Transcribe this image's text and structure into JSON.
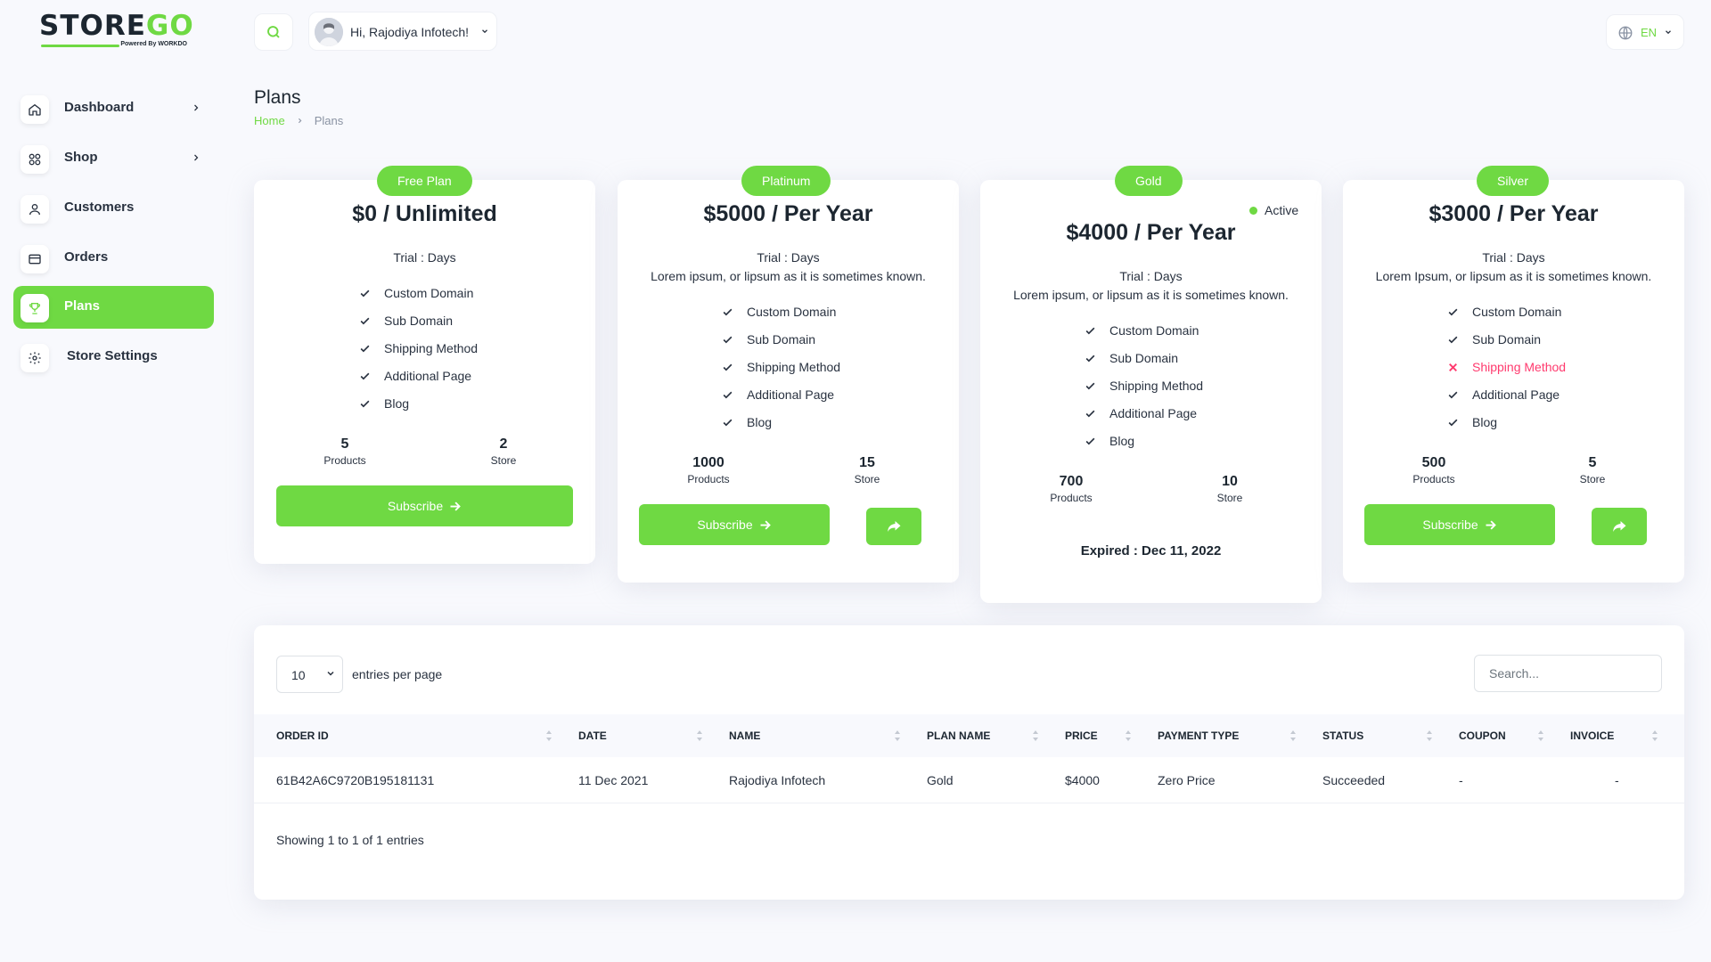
{
  "brand": {
    "name_part1": "STORE",
    "name_part2": "GO",
    "powered_by": "Powered By WORKDO"
  },
  "sidebar": {
    "items": [
      {
        "label": "Dashboard",
        "icon": "home-icon",
        "has_submenu": true
      },
      {
        "label": "Shop",
        "icon": "grid-icon",
        "has_submenu": true
      },
      {
        "label": "Customers",
        "icon": "user-icon",
        "has_submenu": false
      },
      {
        "label": "Orders",
        "icon": "card-icon",
        "has_submenu": false
      },
      {
        "label": "Plans",
        "icon": "trophy-icon",
        "has_submenu": false,
        "active": true
      },
      {
        "label": "Store Settings",
        "icon": "gear-icon",
        "has_submenu": false
      }
    ]
  },
  "header": {
    "user_greeting": "Hi, Rajodiya Infotech!",
    "language": "EN"
  },
  "page": {
    "title": "Plans",
    "breadcrumb": {
      "home": "Home",
      "current": "Plans"
    }
  },
  "plans": [
    {
      "badge": "Free Plan",
      "price": "$0 / Unlimited",
      "trial": "Trial : Days",
      "description": "",
      "features": [
        {
          "label": "Custom Domain",
          "enabled": true
        },
        {
          "label": "Sub Domain",
          "enabled": true
        },
        {
          "label": "Shipping Method",
          "enabled": true
        },
        {
          "label": "Additional Page",
          "enabled": true
        },
        {
          "label": "Blog",
          "enabled": true
        }
      ],
      "products": "5",
      "products_label": "Products",
      "stores": "2",
      "stores_label": "Store",
      "subscribe_label": "Subscribe"
    },
    {
      "badge": "Platinum",
      "price": "$5000 / Per Year",
      "trial": "Trial : Days",
      "description": "Lorem ipsum, or lipsum as it is sometimes known.",
      "features": [
        {
          "label": "Custom Domain",
          "enabled": true
        },
        {
          "label": "Sub Domain",
          "enabled": true
        },
        {
          "label": "Shipping Method",
          "enabled": true
        },
        {
          "label": "Additional Page",
          "enabled": true
        },
        {
          "label": "Blog",
          "enabled": true
        }
      ],
      "products": "1000",
      "products_label": "Products",
      "stores": "15",
      "stores_label": "Store",
      "subscribe_label": "Subscribe"
    },
    {
      "badge": "Gold",
      "status": "Active",
      "price": "$4000 / Per Year",
      "trial": "Trial : Days",
      "description": "Lorem ipsum, or lipsum as it is sometimes known.",
      "features": [
        {
          "label": "Custom Domain",
          "enabled": true
        },
        {
          "label": "Sub Domain",
          "enabled": true
        },
        {
          "label": "Shipping Method",
          "enabled": true
        },
        {
          "label": "Additional Page",
          "enabled": true
        },
        {
          "label": "Blog",
          "enabled": true
        }
      ],
      "products": "700",
      "products_label": "Products",
      "stores": "10",
      "stores_label": "Store",
      "expired": "Expired : Dec 11, 2022"
    },
    {
      "badge": "Silver",
      "price": "$3000 / Per Year",
      "trial": "Trial : Days",
      "description": "Lorem Ipsum, or lipsum as it is sometimes known.",
      "features": [
        {
          "label": "Custom Domain",
          "enabled": true
        },
        {
          "label": "Sub Domain",
          "enabled": true
        },
        {
          "label": "Shipping Method",
          "enabled": false
        },
        {
          "label": "Additional Page",
          "enabled": true
        },
        {
          "label": "Blog",
          "enabled": true
        }
      ],
      "products": "500",
      "products_label": "Products",
      "stores": "5",
      "stores_label": "Store",
      "subscribe_label": "Subscribe"
    }
  ],
  "orders_table": {
    "entries_value": "10",
    "entries_label": "entries per page",
    "search_placeholder": "Search...",
    "columns": [
      "ORDER ID",
      "DATE",
      "NAME",
      "PLAN NAME",
      "PRICE",
      "PAYMENT TYPE",
      "STATUS",
      "COUPON",
      "INVOICE"
    ],
    "rows": [
      [
        "61B42A6C9720B195181131",
        "11 Dec 2021",
        "Rajodiya Infotech",
        "Gold",
        "$4000",
        "Zero Price",
        "Succeeded",
        "-",
        "-"
      ]
    ],
    "footer": "Showing 1 to 1 of 1 entries"
  },
  "colors": {
    "accent": "#6fd943",
    "danger": "#ff3a6e",
    "text": "#293240",
    "background": "#f8f9fd"
  }
}
